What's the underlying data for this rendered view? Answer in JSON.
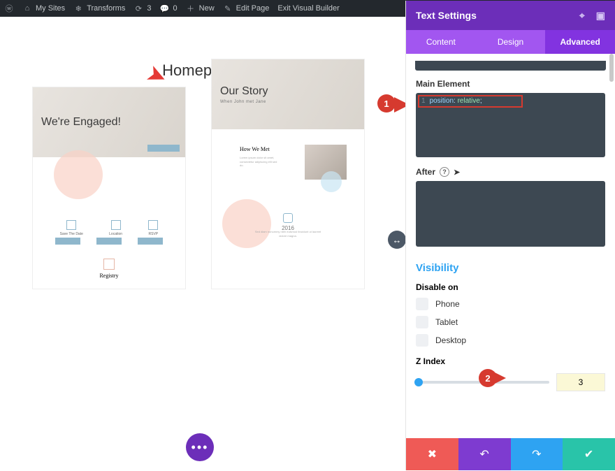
{
  "adminbar": {
    "mysites": "My Sites",
    "transforms": "Transforms",
    "refresh_count": "3",
    "comments_count": "0",
    "new": "New",
    "editpage": "Edit Page",
    "exit": "Exit Visual Builder"
  },
  "page": {
    "title": "Homepage"
  },
  "thumb_left": {
    "hero_title": "We're Engaged!",
    "hero_sub": "",
    "icons": [
      "Save The Date",
      "Location",
      "RSVP"
    ],
    "registry": "Registry"
  },
  "thumb_right": {
    "hero_title": "Our Story",
    "hero_sub": "When John met Jane",
    "howmet": "How We Met",
    "lorem": "Lorem ipsum dolor sit amet, consectetur adipiscing elit sed do.",
    "year": "2016",
    "yearlorem": "Sed diam nonummy nibh euismod tincidunt ut laoreet dolore magna."
  },
  "annotations": {
    "one": "1",
    "two": "2"
  },
  "panel": {
    "title": "Text Settings",
    "tabs": {
      "content": "Content",
      "design": "Design",
      "advanced": "Advanced",
      "active": "advanced"
    },
    "main_element_label": "Main Element",
    "code": {
      "line": "1",
      "prop": "position",
      "val": "relative",
      "end": ";"
    },
    "after_label": "After",
    "visibility": {
      "title": "Visibility",
      "disable_on": "Disable on",
      "phone": "Phone",
      "tablet": "Tablet",
      "desktop": "Desktop"
    },
    "zindex": {
      "label": "Z Index",
      "value": "3"
    }
  }
}
